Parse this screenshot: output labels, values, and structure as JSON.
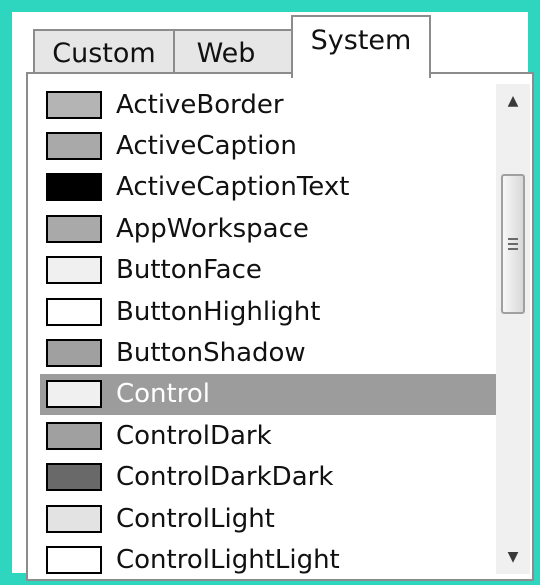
{
  "tabs": [
    {
      "label": "Custom",
      "active": false
    },
    {
      "label": "Web",
      "active": false
    },
    {
      "label": "System",
      "active": true
    }
  ],
  "colors": {
    "frame": "#2fd6bf",
    "selection": "#9c9c9c"
  },
  "items": [
    {
      "label": "ActiveBorder",
      "swatch": "#b4b4b4"
    },
    {
      "label": "ActiveCaption",
      "swatch": "#a9a9a9"
    },
    {
      "label": "ActiveCaptionText",
      "swatch": "#000000"
    },
    {
      "label": "AppWorkspace",
      "swatch": "#a9a9a9"
    },
    {
      "label": "ButtonFace",
      "swatch": "#f0f0f0"
    },
    {
      "label": "ButtonHighlight",
      "swatch": "#ffffff"
    },
    {
      "label": "ButtonShadow",
      "swatch": "#a0a0a0"
    },
    {
      "label": "Control",
      "swatch": "#f0f0f0",
      "selected": true
    },
    {
      "label": "ControlDark",
      "swatch": "#a0a0a0"
    },
    {
      "label": "ControlDarkDark",
      "swatch": "#696969"
    },
    {
      "label": "ControlLight",
      "swatch": "#e3e3e3"
    },
    {
      "label": "ControlLightLight",
      "swatch": "#ffffff"
    }
  ],
  "scrollbar": {
    "up_icon": "arrow-up-icon",
    "down_icon": "arrow-down-icon",
    "thumb_position": 0.2
  }
}
